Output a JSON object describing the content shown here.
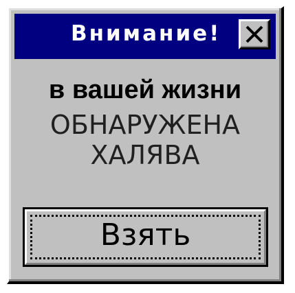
{
  "dialog": {
    "title": "Внимание!",
    "message_line1": "в вашей жизни",
    "message_line2": "ОБНАРУЖЕНА",
    "message_line3": "ХАЛЯВА",
    "button_label": "Взять",
    "close_icon": "close-icon"
  },
  "colors": {
    "titlebar": "#000080",
    "window": "#c0c0c0",
    "title_text": "#ffffff"
  }
}
